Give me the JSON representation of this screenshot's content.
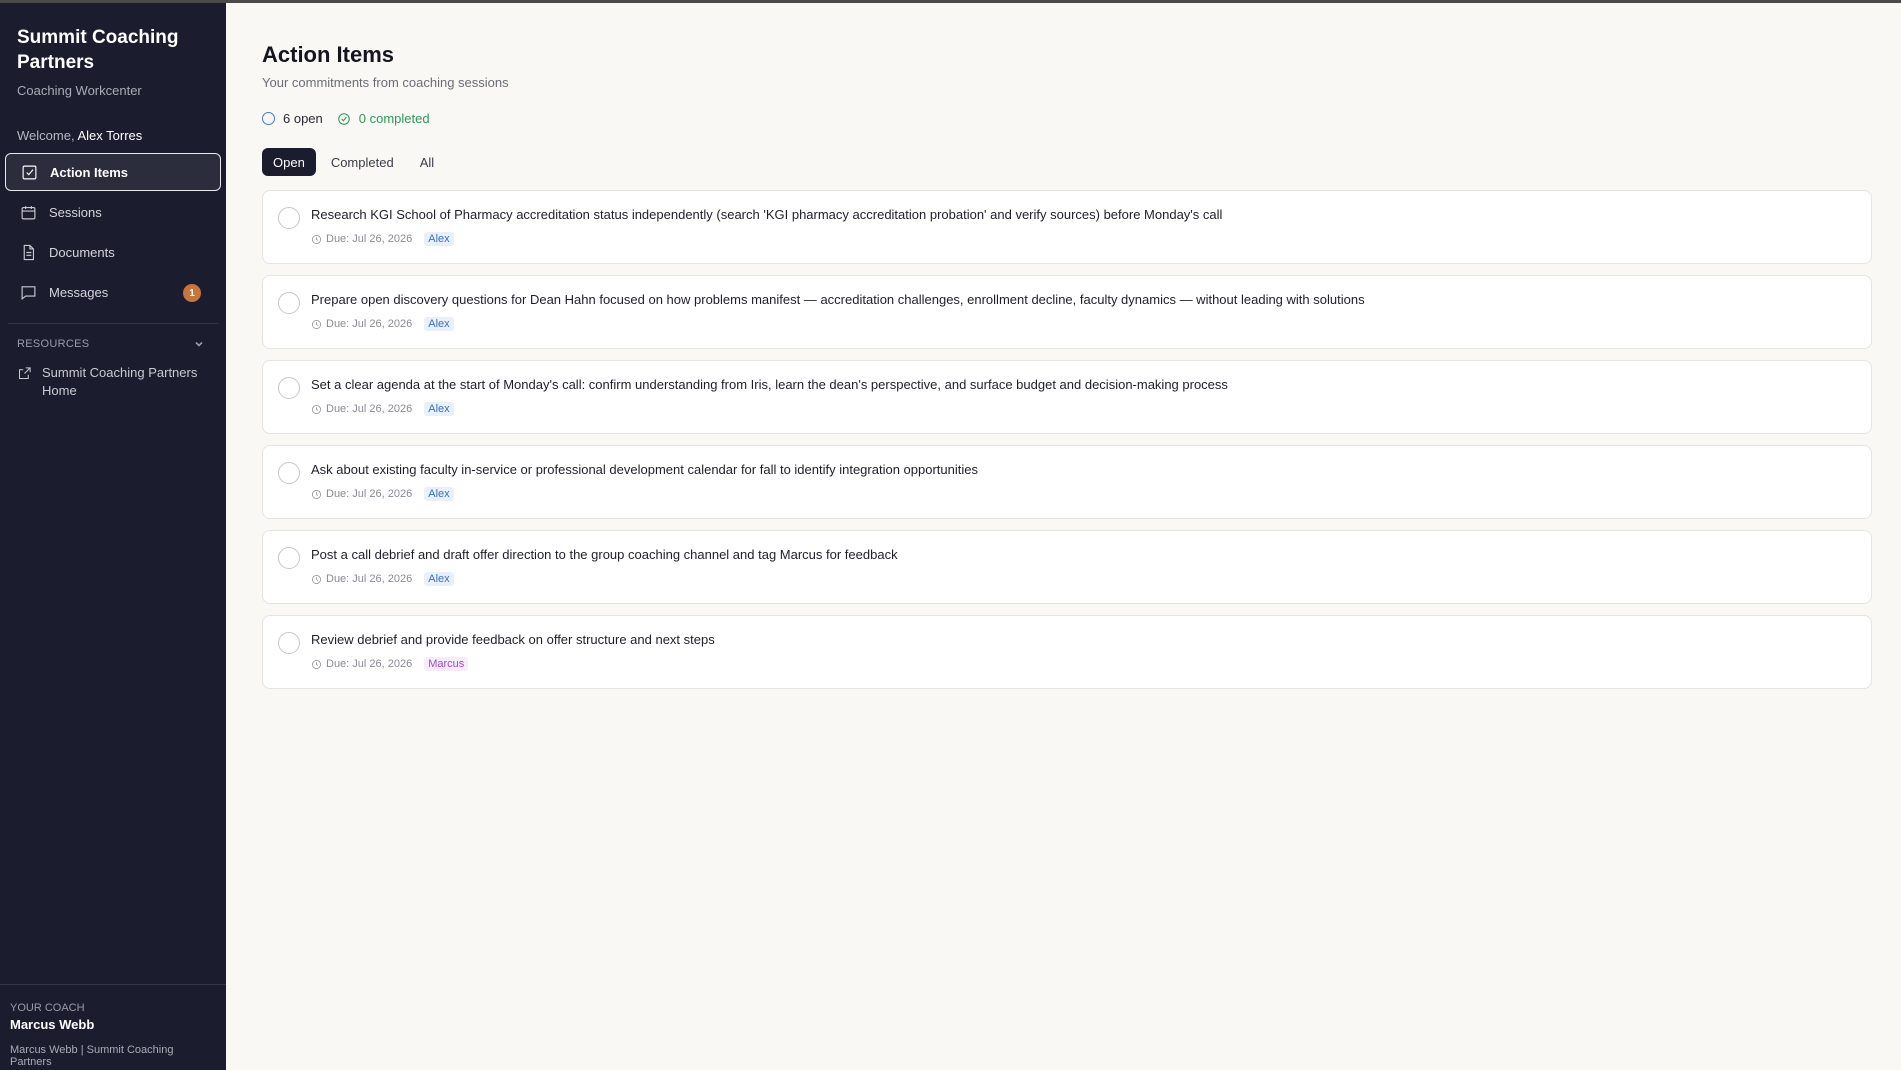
{
  "sidebar": {
    "brand_title": "Summit Coaching Partners",
    "brand_sub": "Coaching Workcenter",
    "welcome_prefix": "Welcome,",
    "user_name": "Alex Torres",
    "nav": [
      {
        "label": "Action Items",
        "icon": "checkbox-icon"
      },
      {
        "label": "Sessions",
        "icon": "calendar-icon"
      },
      {
        "label": "Documents",
        "icon": "document-icon"
      },
      {
        "label": "Messages",
        "icon": "chat-icon",
        "badge": "1"
      }
    ],
    "resources_label": "RESOURCES",
    "resources": [
      {
        "label": "Summit Coaching Partners Home",
        "icon": "external-link-icon"
      }
    ],
    "coach_label": "YOUR COACH",
    "coach_name": "Marcus Webb",
    "coach_meta": "Marcus Webb | Summit Coaching Partners"
  },
  "main": {
    "title": "Action Items",
    "subtitle": "Your commitments from coaching sessions",
    "open_count": "6 open",
    "completed_count": "0 completed",
    "tabs": [
      "Open",
      "Completed",
      "All"
    ],
    "active_tab": "Open",
    "items": [
      {
        "text": "Research KGI School of Pharmacy accreditation status independently (search 'KGI pharmacy accreditation probation' and verify sources) before Monday's call",
        "due": "Due: Jul 26, 2026",
        "owner": "Alex"
      },
      {
        "text": "Prepare open discovery questions for Dean Hahn focused on how problems manifest — accreditation challenges, enrollment decline, faculty dynamics — without leading with solutions",
        "due": "Due: Jul 26, 2026",
        "owner": "Alex"
      },
      {
        "text": "Set a clear agenda at the start of Monday's call: confirm understanding from Iris, learn the dean's perspective, and surface budget and decision-making process",
        "due": "Due: Jul 26, 2026",
        "owner": "Alex"
      },
      {
        "text": "Ask about existing faculty in-service or professional development calendar for fall to identify integration opportunities",
        "due": "Due: Jul 26, 2026",
        "owner": "Alex"
      },
      {
        "text": "Post a call debrief and draft offer direction to the group coaching channel and tag Marcus for feedback",
        "due": "Due: Jul 26, 2026",
        "owner": "Alex"
      },
      {
        "text": "Review debrief and provide feedback on offer structure and next steps",
        "due": "Due: Jul 26, 2026",
        "owner": "Marcus"
      }
    ]
  },
  "colors": {
    "sidebar_bg": "#1b1d2e",
    "page_bg": "#f9f8f5",
    "open_accent": "#3f7bd6",
    "completed_accent": "#2d9a56",
    "badge": "#c8743a",
    "tag_alex": "#3a6fc2",
    "tag_marcus": "#a04ac9"
  }
}
